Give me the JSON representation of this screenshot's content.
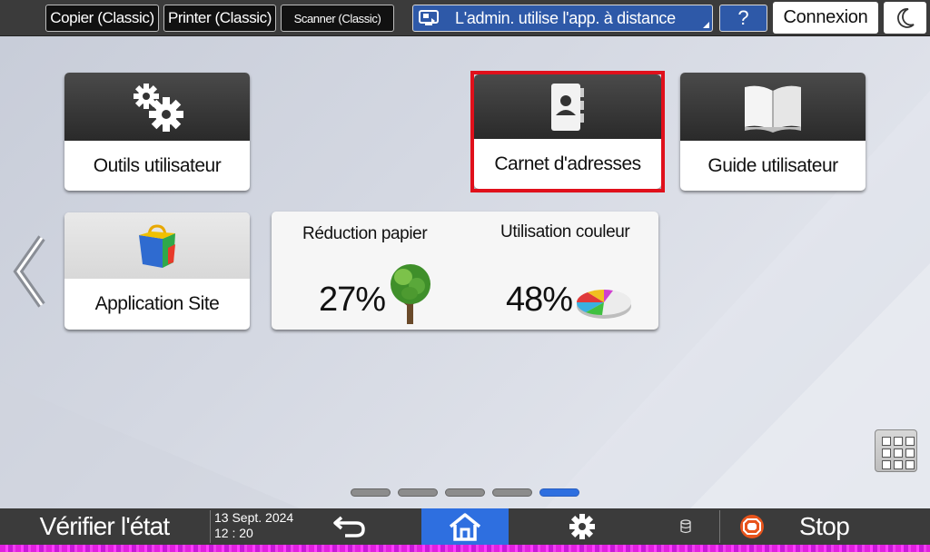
{
  "topbar": {
    "copier_label": "Copier (Classic)",
    "printer_label": "Printer (Classic)",
    "scanner_label": "Scanner (Classic)",
    "remote_label": "L'admin. utilise l'app. à distance",
    "help_label": "?",
    "login_label": "Connexion"
  },
  "tiles": {
    "user_tools": "Outils utilisateur",
    "address_book": "Carnet d'adresses",
    "user_guide": "Guide utilisateur",
    "application_site": "Application Site"
  },
  "stats": {
    "paper_reduction_title": "Réduction papier",
    "paper_reduction_value": "27%",
    "color_usage_title": "Utilisation couleur",
    "color_usage_value": "48%"
  },
  "pager": {
    "pages": 5,
    "active_index": 4
  },
  "bottombar": {
    "status_label": "Vérifier l'état",
    "date": "13 Sept. 2024",
    "time": "12 : 20",
    "stop_label": "Stop"
  },
  "colors": {
    "accent_blue": "#2e6fe0",
    "remote_blue": "#2e59a8",
    "selection_red": "#e0101b",
    "bar_gray": "#3b3b3b"
  },
  "icons": [
    "gears-icon",
    "address-book-icon",
    "book-icon",
    "shopping-bag-icon",
    "tree-icon",
    "pie-chart-icon",
    "back-arrow-icon",
    "home-icon",
    "settings-gear-icon",
    "database-icon",
    "stop-icon",
    "apps-grid-icon",
    "moon-icon",
    "remote-monitor-icon",
    "chevron-left-icon"
  ]
}
